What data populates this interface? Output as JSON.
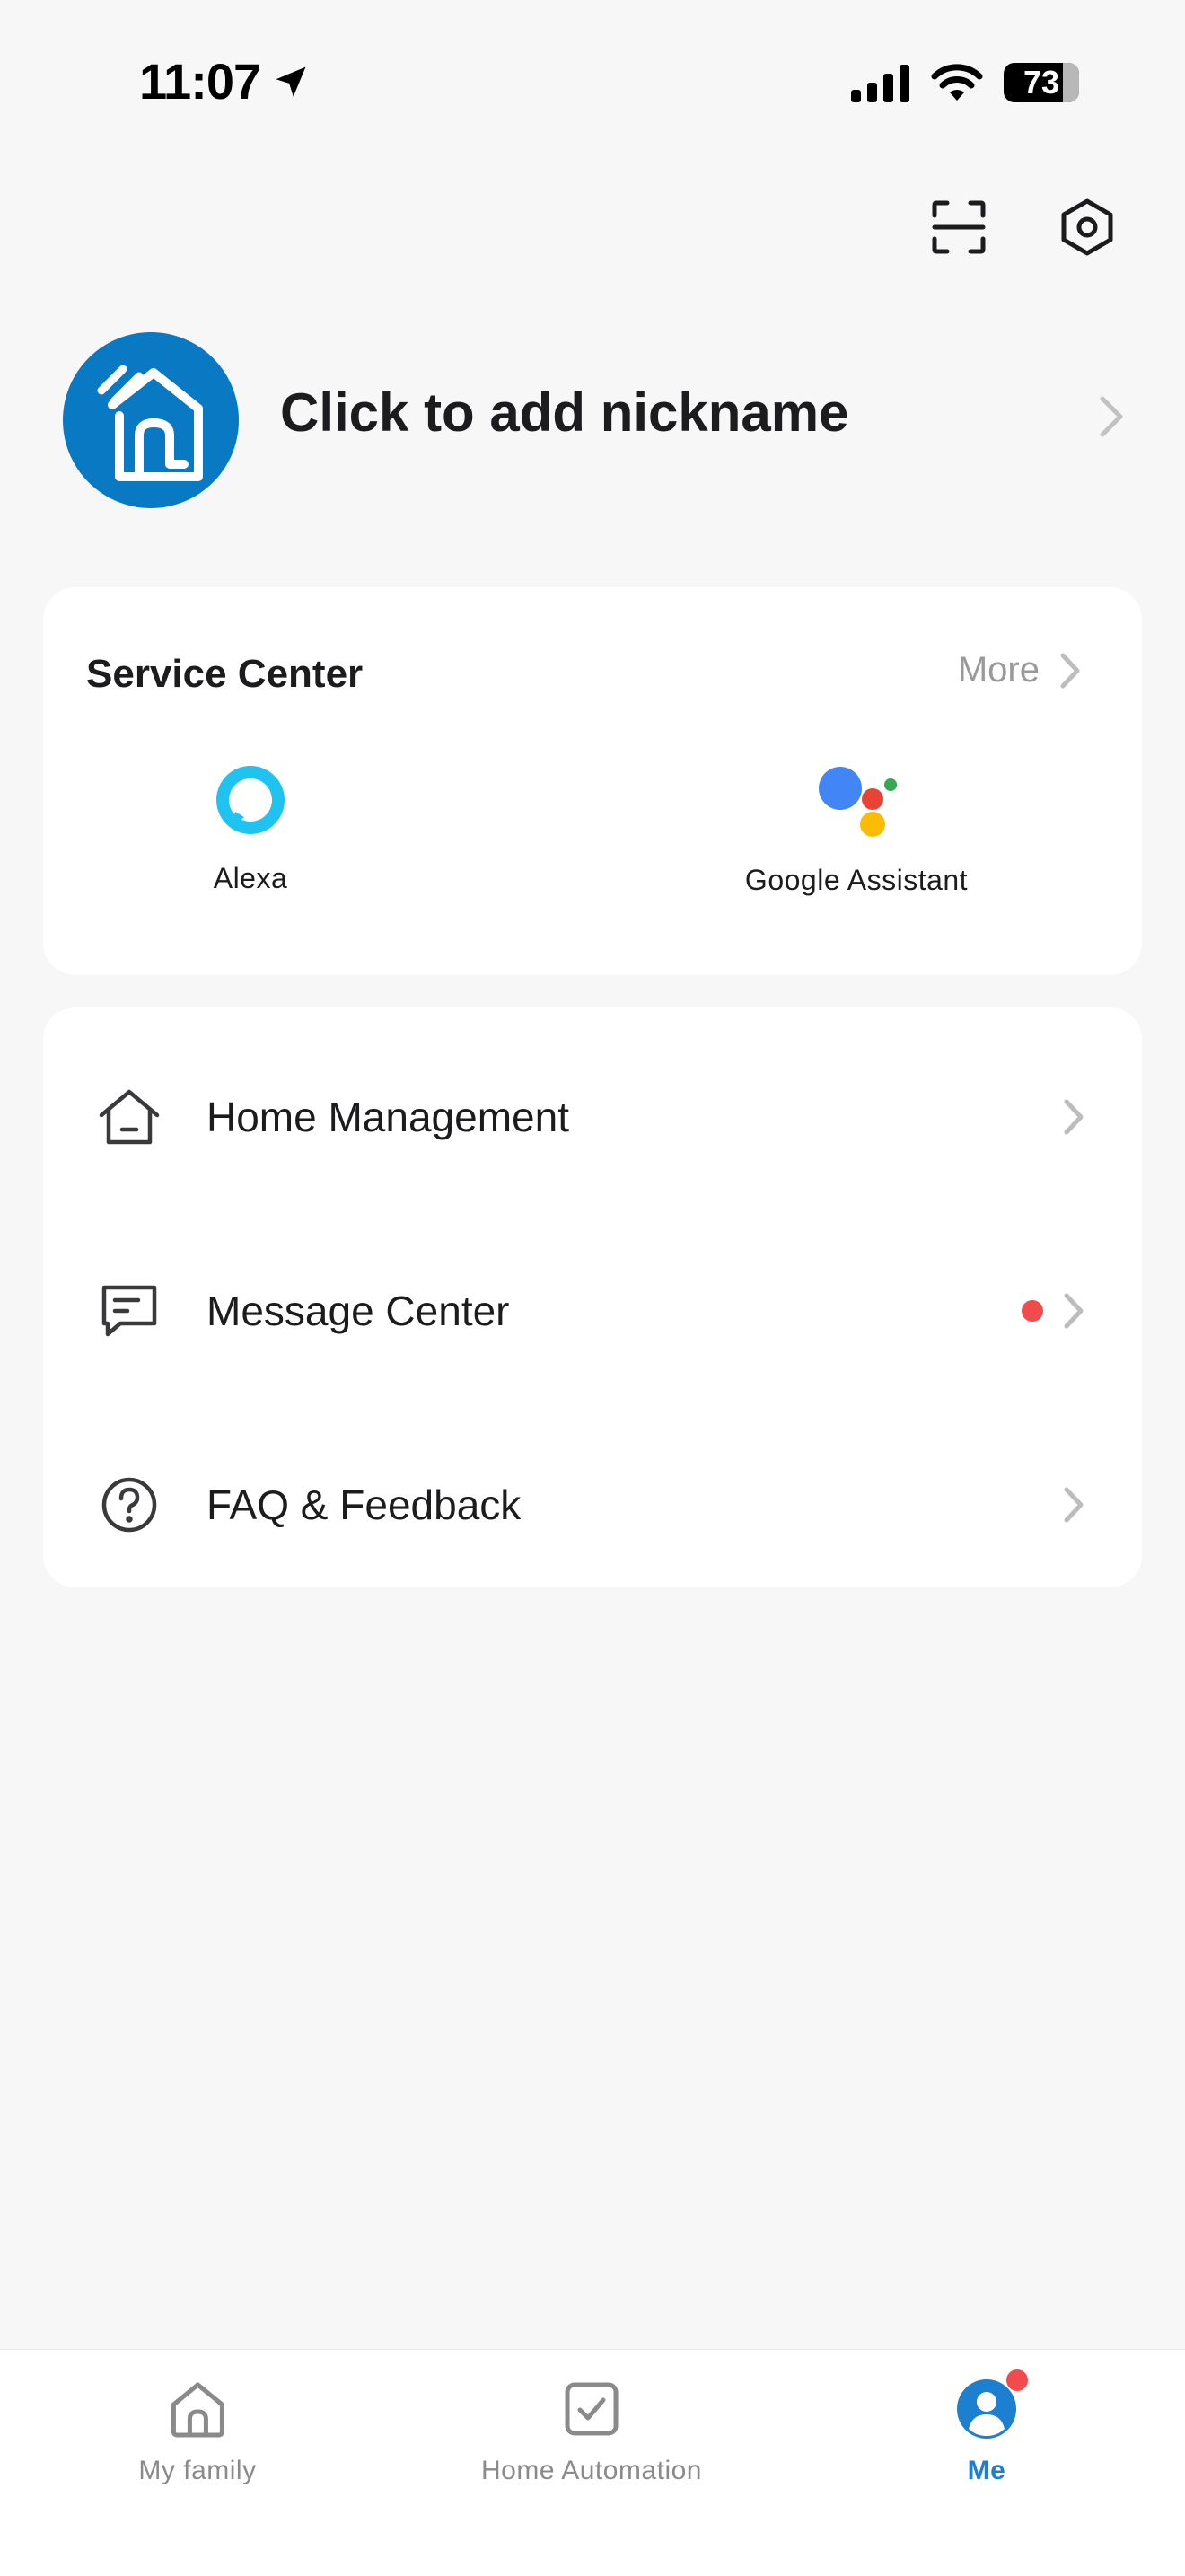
{
  "status_bar": {
    "time": "11:07",
    "battery": "73"
  },
  "profile": {
    "nickname": "Click to add nickname"
  },
  "service_center": {
    "title": "Service Center",
    "more_label": "More",
    "items": [
      {
        "label": "Alexa",
        "icon": "alexa-icon"
      },
      {
        "label": "Google Assistant",
        "icon": "google-assistant-icon"
      }
    ]
  },
  "menu": {
    "items": [
      {
        "label": "Home Management",
        "icon": "home-icon"
      },
      {
        "label": "Message Center",
        "icon": "message-icon",
        "has_dot": true
      },
      {
        "label": "FAQ & Feedback",
        "icon": "question-icon"
      }
    ]
  },
  "tabs": [
    {
      "label": "My family",
      "icon": "house-tab-icon",
      "active": false
    },
    {
      "label": "Home Automation",
      "icon": "checkbox-tab-icon",
      "active": false
    },
    {
      "label": "Me",
      "icon": "profile-tab-icon",
      "active": true,
      "badge": true
    }
  ],
  "colors": {
    "accent": "#1c7fd0",
    "avatar_bg": "#0a79c4",
    "badge": "#f24b4b",
    "background": "#f7f7f7"
  }
}
